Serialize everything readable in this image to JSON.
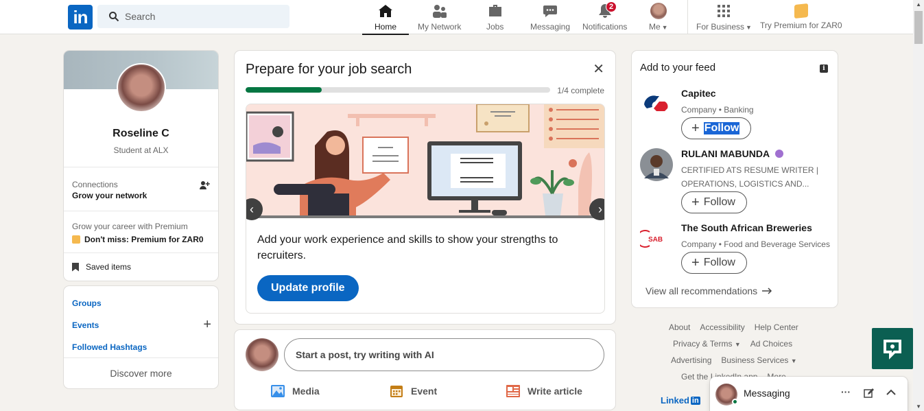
{
  "header": {
    "logo_text": "in",
    "search_placeholder": "Search",
    "nav": [
      {
        "label": "Home",
        "icon": "home-icon"
      },
      {
        "label": "My Network",
        "icon": "network-icon"
      },
      {
        "label": "Jobs",
        "icon": "briefcase-icon"
      },
      {
        "label": "Messaging",
        "icon": "chat-icon"
      },
      {
        "label": "Notifications",
        "icon": "bell-icon",
        "badge": "2"
      },
      {
        "label": "Me",
        "icon": "avatar"
      },
      {
        "label": "For Business",
        "icon": "grid-icon"
      },
      {
        "label": "Try Premium for ZAR0",
        "icon": "premium-icon"
      }
    ]
  },
  "profile": {
    "name": "Roseline C",
    "headline": "Student at ALX",
    "connections_label": "Connections",
    "connections_sub": "Grow your network",
    "premium_label": "Grow your career with Premium",
    "premium_link": "Don't miss: Premium for ZAR0",
    "saved_items": "Saved items"
  },
  "groups": {
    "groups": "Groups",
    "events": "Events",
    "hashtags": "Followed Hashtags",
    "discover": "Discover more"
  },
  "job_search": {
    "title": "Prepare for your job search",
    "progress_text": "1/4 complete",
    "progress": 0.25,
    "description": "Add your work experience and skills to show your strengths to recruiters.",
    "button": "Update profile",
    "prev": "‹",
    "next": "›",
    "close": "✕"
  },
  "post": {
    "placeholder": "Start a post, try writing with AI",
    "media": "Media",
    "event": "Event",
    "article": "Write article"
  },
  "feed": {
    "title": "Add to your feed",
    "info": "i",
    "recommendations": [
      {
        "name": "Capitec",
        "meta": "Company • Banking",
        "follow_plus": "+",
        "follow": "Follow"
      },
      {
        "name": "RULANI MABUNDA",
        "meta": "CERTIFIED ATS RESUME WRITER | OPERATIONS, LOGISTICS AND...",
        "follow_plus": "+",
        "follow": "Follow"
      },
      {
        "name": "The South African Breweries",
        "meta": "Company • Food and Beverage Services",
        "follow_plus": "+",
        "follow": "Follow"
      }
    ],
    "view_all": "View all recommendations"
  },
  "footer": {
    "row1": [
      "About",
      "Accessibility",
      "Help Center"
    ],
    "row2": [
      "Privacy & Terms",
      "Ad Choices"
    ],
    "row3": [
      "Advertising",
      "Business Services"
    ],
    "row4": [
      "Get the LinkedIn app",
      "More"
    ],
    "brand": "Linked",
    "brand_box": "in"
  },
  "messaging": {
    "label": "Messaging",
    "more": "···"
  },
  "colors": {
    "brand": "#0a66c2",
    "progress": "#057642",
    "badge": "#cb112d"
  }
}
